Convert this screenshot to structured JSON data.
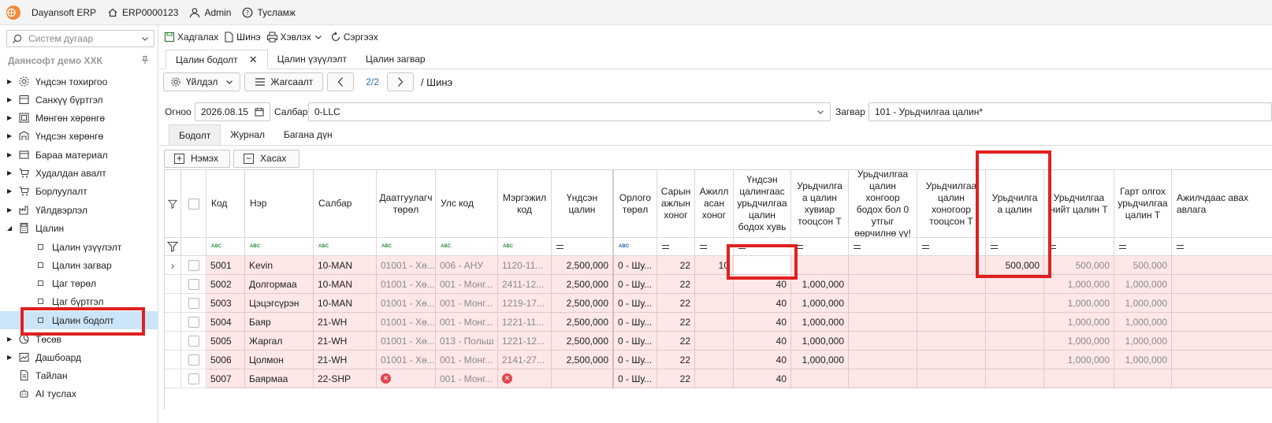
{
  "titlebar": {
    "app_name": "Dayansoft ERP",
    "db_code": "ERP0000123",
    "user": "Admin",
    "help": "Тусламж"
  },
  "sidebar": {
    "search_placeholder": "Систем дугаар",
    "company": "Даянсофт демо ХХК",
    "items": [
      {
        "label": "Үндсэн тохиргоо",
        "icon": "gear-icon"
      },
      {
        "label": "Санхүү бүртгэл",
        "icon": "ledger-icon"
      },
      {
        "label": "Мөнгөн хөрөнгө",
        "icon": "cash-icon"
      },
      {
        "label": "Үндсэн хөрөнгө",
        "icon": "building-icon"
      },
      {
        "label": "Бараа материал",
        "icon": "box-icon"
      },
      {
        "label": "Худалдан авалт",
        "icon": "cart-icon"
      },
      {
        "label": "Борлуулалт",
        "icon": "cart-icon"
      },
      {
        "label": "Үйлдвэрлэл",
        "icon": "factory-icon"
      },
      {
        "label": "Цалин",
        "icon": "calculator-icon"
      }
    ],
    "salary_children": [
      "Цалин үзүүлэлт",
      "Цалин загвар",
      "Цаг төрөл",
      "Цаг бүртгэл",
      "Цалин бодолт"
    ],
    "items_after": [
      {
        "label": "Төсөв",
        "icon": "pie-icon"
      },
      {
        "label": "Дашбоард",
        "icon": "dashboard-icon"
      },
      {
        "label": "Тайлан",
        "icon": "report-icon"
      },
      {
        "label": "AI туслах",
        "icon": "robot-icon"
      }
    ]
  },
  "toolbar": {
    "save": "Хадгалах",
    "new": "Шинэ",
    "print": "Хэвлэх",
    "refresh": "Сэргээх"
  },
  "doctabs": [
    "Цалин бодолт",
    "Цалин үзүүлэлт",
    "Цалин загвар"
  ],
  "navrow": {
    "action": "Үйлдэл",
    "list": "Жагсаалт",
    "pager": "2/2",
    "crumb": "/ Шинэ"
  },
  "filters": {
    "date_label": "Огноо",
    "date_value": "2026.08.15",
    "branch_label": "Салбар",
    "branch_value": "0-LLC",
    "template_label": "Загвар",
    "template_value": "101 - Урьдчилгаа цалин*"
  },
  "subtabs": [
    "Бодолт",
    "Журнал",
    "Багана дүн"
  ],
  "actions": {
    "add": "Нэмэх",
    "remove": "Хасах"
  },
  "grid": {
    "headers": [
      "Код",
      "Нэр",
      "Салбар",
      "Даатгуулагч төрөл",
      "Улс код",
      "Мэргэжил код",
      "Үндсэн цалин",
      "Орлого төрөл",
      "Сарын ажлын хоног",
      "Ажилл асан хоног",
      "Үндсэн цалингаас урьдчилгаа цалин бодох хувь",
      "Урьдчилга а цалин хувиар тооцсон Т",
      "Урьдчилгаа цалин хонгоор бодох бол 0 утгыг өөрчилнө үү!",
      "Урьдчилгаа цалин хоногоор тооцсон Т",
      "Урьдчилга а цалин",
      "Урьдчилгаа нийт цалин Т",
      "Гарт олгох урьдчилгаа цалин Т",
      "Ажилчдаас авах авлага"
    ],
    "rows": [
      {
        "code": "5001",
        "name": "Kevin",
        "branch": "10-MAN",
        "insured": "01001 - Хө...",
        "country": "006 - АНУ",
        "prof": "1120-11...",
        "base": "2,500,000",
        "income": "0 - Шу...",
        "month_days": "22",
        "worked": "10",
        "pct": "",
        "pct_amt": "",
        "days_adj": "",
        "days_amt": "",
        "advance": "500,000",
        "total": "500,000",
        "net": "500,000",
        "recv": ""
      },
      {
        "code": "5002",
        "name": "Долгормаа",
        "branch": "10-MAN",
        "insured": "01001 - Хө...",
        "country": "001 - Монг...",
        "prof": "2411-12...",
        "base": "2,500,000",
        "income": "0 - Шу...",
        "month_days": "22",
        "worked": "",
        "pct": "40",
        "pct_amt": "1,000,000",
        "days_adj": "",
        "days_amt": "",
        "advance": "",
        "total": "1,000,000",
        "net": "1,000,000",
        "recv": ""
      },
      {
        "code": "5003",
        "name": "Цэцэгсүрэн",
        "branch": "10-MAN",
        "insured": "01001 - Хө...",
        "country": "001 - Монг...",
        "prof": "1219-17...",
        "base": "2,500,000",
        "income": "0 - Шу...",
        "month_days": "22",
        "worked": "",
        "pct": "40",
        "pct_amt": "1,000,000",
        "days_adj": "",
        "days_amt": "",
        "advance": "",
        "total": "1,000,000",
        "net": "1,000,000",
        "recv": ""
      },
      {
        "code": "5004",
        "name": "Баяр",
        "branch": "21-WH",
        "insured": "01001 - Хө...",
        "country": "001 - Монг...",
        "prof": "1221-11...",
        "base": "2,500,000",
        "income": "0 - Шу...",
        "month_days": "22",
        "worked": "",
        "pct": "40",
        "pct_amt": "1,000,000",
        "days_adj": "",
        "days_amt": "",
        "advance": "",
        "total": "1,000,000",
        "net": "1,000,000",
        "recv": ""
      },
      {
        "code": "5005",
        "name": "Жаргал",
        "branch": "21-WH",
        "insured": "01001 - Хө...",
        "country": "013 - Польш",
        "prof": "1221-12...",
        "base": "2,500,000",
        "income": "0 - Шу...",
        "month_days": "22",
        "worked": "",
        "pct": "40",
        "pct_amt": "1,000,000",
        "days_adj": "",
        "days_amt": "",
        "advance": "",
        "total": "1,000,000",
        "net": "1,000,000",
        "recv": ""
      },
      {
        "code": "5006",
        "name": "Цолмон",
        "branch": "21-WH",
        "insured": "01001 - Хө...",
        "country": "001 - Монг...",
        "prof": "2141-27...",
        "base": "2,500,000",
        "income": "0 - Шу...",
        "month_days": "22",
        "worked": "",
        "pct": "40",
        "pct_amt": "1,000,000",
        "days_adj": "",
        "days_amt": "",
        "advance": "",
        "total": "1,000,000",
        "net": "1,000,000",
        "recv": ""
      },
      {
        "code": "5007",
        "name": "Баярмаа",
        "branch": "22-SHP",
        "insured": "",
        "country": "001 - Монг...",
        "prof": "",
        "base": "",
        "income": "0 - Шу...",
        "month_days": "22",
        "worked": "",
        "pct": "40",
        "pct_amt": "",
        "days_adj": "",
        "days_amt": "",
        "advance": "",
        "total": "",
        "net": "",
        "recv": ""
      }
    ]
  },
  "colors": {
    "row_error_bg": "#fde7e7",
    "selection": "#cce4f7",
    "annotation": "#e02020",
    "pager": "#2a6fb0"
  }
}
